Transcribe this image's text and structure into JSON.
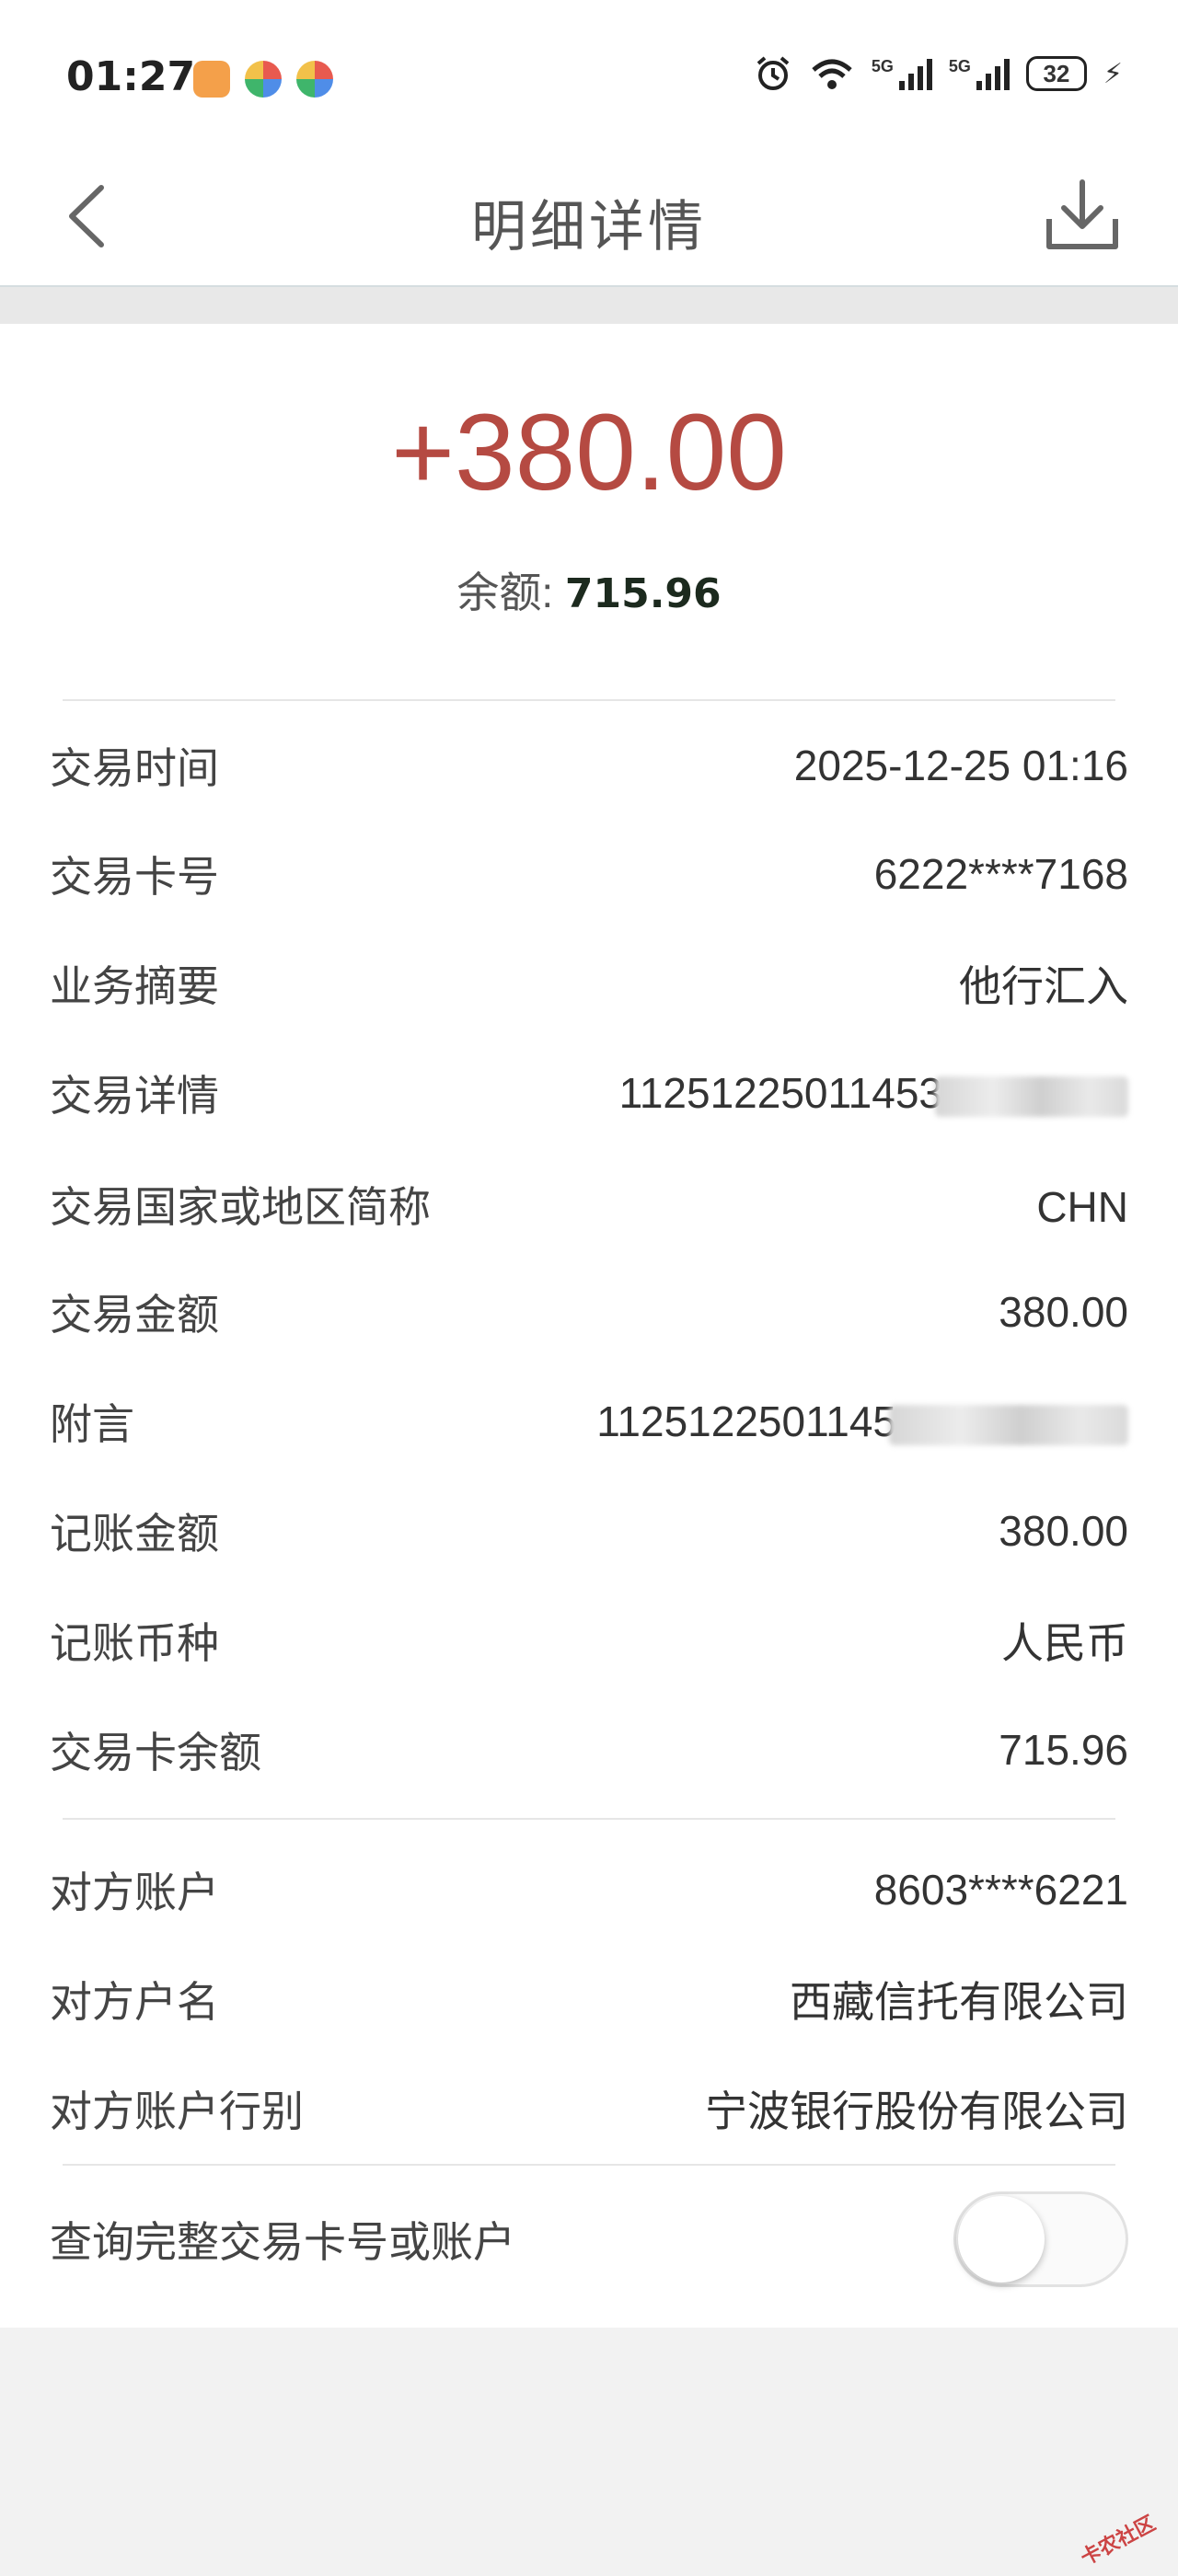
{
  "status_bar": {
    "time": "01:27",
    "icons": [
      "alarm-icon",
      "wifi-icon",
      "signal-5g-icon",
      "signal-5g-icon",
      "battery-icon",
      "charging-icon"
    ],
    "network_labels": [
      "5G",
      "5G"
    ],
    "battery_level": "32"
  },
  "nav": {
    "title": "明细详情",
    "back_icon": "chevron-left-icon",
    "download_icon": "download-icon"
  },
  "summary": {
    "amount": "+380.00",
    "amount_color": "#b54a42",
    "balance_label": "余额: ",
    "balance_value": "715.96"
  },
  "details": [
    {
      "label": "交易时间",
      "value": "2025-12-25 01:16"
    },
    {
      "label": "交易卡号",
      "value": "6222****7168"
    },
    {
      "label": "业务摘要",
      "value": "他行汇入"
    },
    {
      "label": "交易详情",
      "value": "11251225011453"
    },
    {
      "label": "交易国家或地区简称",
      "value": "CHN"
    },
    {
      "label": "交易金额",
      "value": "380.00"
    },
    {
      "label": "附言",
      "value": "1125122501145"
    },
    {
      "label": "记账金额",
      "value": "380.00"
    },
    {
      "label": "记账币种",
      "value": "人民币"
    },
    {
      "label": "交易卡余额",
      "value": "715.96"
    }
  ],
  "counterparty": [
    {
      "label": "对方账户",
      "value": "8603****6221"
    },
    {
      "label": "对方户名",
      "value": "西藏信托有限公司"
    },
    {
      "label": "对方账户行别",
      "value": "宁波银行股份有限公司"
    }
  ],
  "full_number_toggle": {
    "label": "查询完整交易卡号或账户",
    "state": "off"
  },
  "watermark": "卡农社区"
}
